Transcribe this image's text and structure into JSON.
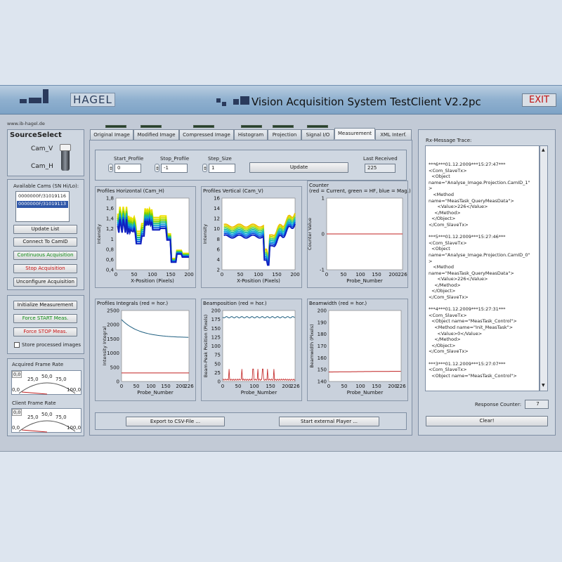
{
  "app": {
    "title": "Vision Acquisition System TestClient V2.2pc",
    "brand": "HAGEL",
    "exit_label": "EXIT",
    "url": "www.ib-hagel.de"
  },
  "source_select": {
    "title": "SourceSelect",
    "cam_v": "Cam_V",
    "cam_h": "Cam_H"
  },
  "cams": {
    "label": "Available Cams (SN Hi/Lo):",
    "items": [
      "0000000F/31019116",
      "0000000F/31019113"
    ],
    "selected_index": 1
  },
  "buttons": {
    "update_list": "Update List",
    "connect": "Connect To CamID",
    "continuous": "Continuous Acquisition",
    "stop": "Stop Acquisition",
    "unconfigure": "Unconfigure Acquisition",
    "init_meas": "Initialize Measurement",
    "force_start": "Force START Meas.",
    "force_stop": "Force STOP Meas.",
    "store_label": "Store processed images",
    "export": "Export to CSV-File ...",
    "player": "Start external Player ...",
    "update": "Update",
    "clear": "Clear!"
  },
  "acquired_rate": {
    "label": "Acquired Frame Rate",
    "value": "0,0",
    "ticks": [
      "0,0",
      "25,0",
      "50,0",
      "75,0",
      "100,0"
    ]
  },
  "client_rate": {
    "label": "Client Frame Rate",
    "value": "0,0",
    "ticks": [
      "0,0",
      "25,0",
      "50,0",
      "75,0",
      "100,0"
    ]
  },
  "tabs": [
    "Original Image",
    "Modified Image",
    "Compressed Image",
    "Histogram",
    "Projection",
    "Signal I/O",
    "Measurement",
    "XML Interf."
  ],
  "params": {
    "start_label": "Start_Profile",
    "start_value": "0",
    "stop_label": "Stop_Profile",
    "stop_value": "-1",
    "step_label": "Step_Size",
    "step_value": "1",
    "last_label": "Last Received",
    "last_value": "225"
  },
  "plots": {
    "p1": {
      "title": "Profiles Horizontal (Cam_H)",
      "ylabel": "Intensity",
      "xlabel": "X-Position (Pixels)",
      "yticks": [
        "1,8",
        "1,6",
        "1,4",
        "1,2",
        "1",
        "0,8",
        "0,6",
        "0,4"
      ],
      "xticks": [
        "0",
        "50",
        "100",
        "150",
        "200"
      ]
    },
    "p2": {
      "title": "Profiles Vertical (Cam_V)",
      "ylabel": "Intensity",
      "xlabel": "X-Position (Pixels)",
      "yticks": [
        "16",
        "14",
        "12",
        "10",
        "8",
        "6",
        "4",
        "2"
      ],
      "xticks": [
        "0",
        "50",
        "100",
        "150",
        "200"
      ]
    },
    "p3": {
      "title": "Counter",
      "subtitle": "(red = Current, green = HF, blue = Mag.)",
      "ylabel": "Counter Value",
      "xlabel": "Probe_Number",
      "yticks": [
        "1",
        "0",
        "-1"
      ],
      "xticks": [
        "0",
        "50",
        "100",
        "150",
        "200",
        "226"
      ]
    },
    "p4": {
      "title": "Profiles Integrals   (red = hor.)",
      "ylabel": "Intensity Integral",
      "xlabel": "Probe_Number",
      "yticks": [
        "2500",
        "2000",
        "1500",
        "1000",
        "500",
        "0"
      ],
      "xticks": [
        "0",
        "50",
        "100",
        "150",
        "200",
        "226"
      ]
    },
    "p5": {
      "title": "Beamposition    (red = hor.)",
      "ylabel": "Beam-Peak Position (Pixels)",
      "xlabel": "Probe_Number",
      "yticks": [
        "200",
        "175",
        "150",
        "125",
        "100",
        "75",
        "50",
        "25",
        "0"
      ],
      "xticks": [
        "0",
        "50",
        "100",
        "150",
        "200",
        "226"
      ]
    },
    "p6": {
      "title": "Beamwidth    (red = hor.)",
      "ylabel": "Beamwidth (Pixels)",
      "xlabel": "Probe_Number",
      "yticks": [
        "200",
        "190",
        "180",
        "170",
        "160",
        "150",
        "140"
      ],
      "xticks": [
        "0",
        "50",
        "100",
        "150",
        "200",
        "226"
      ]
    }
  },
  "rx": {
    "label": "Rx-Message Trace:",
    "text": "***6***01.12.2009***15:27:47***\n<Com_SlaveTx>\n  <Object\nname=\"Analyse_Image.Projection.CamID_1\"\n>\n   <Method\nname=\"MeasTask_QueryMeasData\">\n      <Value>226</Value>\n    </Method>\n  </Object>\n</Com_SlaveTx>\n\n***5***01.12.2009***15:27:46***\n<Com_SlaveTx>\n  <Object\nname=\"Analyse_Image.Projection.CamID_0\"\n>\n   <Method\nname=\"MeasTask_QueryMeasData\">\n      <Value>226</Value>\n    </Method>\n  </Object>\n</Com_SlaveTx>\n\n***4***01.12.2009***15:27:31***\n<Com_SlaveTx>\n  <Object name=\"MeasTask_Control\">\n    <Method name=\"Init_MeasTask\">\n      <Value>0</Value>\n    </Method>\n  </Object>\n</Com_SlaveTx>\n\n***3***01.12.2009***15:27:07***\n<Com_SlaveTx>\n  <Object name=\"MeasTask_Control\">",
    "response_label": "Response Counter:",
    "response_value": "7"
  }
}
